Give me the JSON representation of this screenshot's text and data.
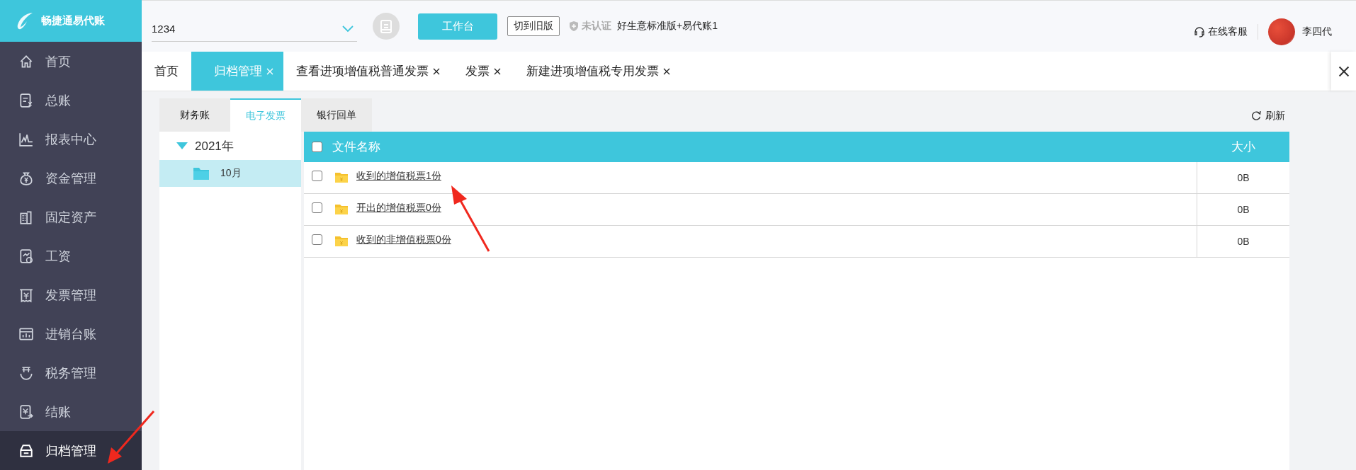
{
  "logo": {
    "text": "畅捷通易代账"
  },
  "topbar": {
    "company_select": {
      "value": "1234"
    },
    "workbench_button": "工作台",
    "old_version_button": "切到旧版",
    "cert_status": "未认证",
    "product": "好生意标准版+易代账1",
    "support": "在线客服",
    "user": "李四代"
  },
  "sidebar": {
    "items": [
      {
        "label": "首页",
        "selected": false
      },
      {
        "label": "总账",
        "selected": false
      },
      {
        "label": "报表中心",
        "selected": false
      },
      {
        "label": "资金管理",
        "selected": false
      },
      {
        "label": "固定资产",
        "selected": false
      },
      {
        "label": "工资",
        "selected": false
      },
      {
        "label": "发票管理",
        "selected": false
      },
      {
        "label": "进销台账",
        "selected": false
      },
      {
        "label": "税务管理",
        "selected": false
      },
      {
        "label": "结账",
        "selected": false
      },
      {
        "label": "归档管理",
        "selected": true
      }
    ]
  },
  "tabs": [
    {
      "label": "首页",
      "closable": false,
      "selected": false
    },
    {
      "label": "归档管理",
      "closable": true,
      "selected": true
    },
    {
      "label": "查看进项增值税普通发票",
      "closable": true,
      "selected": false
    },
    {
      "label": "发票",
      "closable": true,
      "selected": false
    },
    {
      "label": "新建进项增值税专用发票",
      "closable": true,
      "selected": false
    }
  ],
  "subtabs": [
    {
      "label": "财务账",
      "selected": false
    },
    {
      "label": "电子发票",
      "selected": true
    },
    {
      "label": "银行回单",
      "selected": false
    }
  ],
  "refresh": "刷新",
  "tree": [
    {
      "label": "2021年",
      "expanded": true,
      "children": [
        {
          "label": "10月",
          "selected": true
        }
      ]
    }
  ],
  "table": {
    "columns": [
      "文件名称",
      "大小"
    ],
    "header_checked": false,
    "rows": [
      {
        "checked": false,
        "name": "收到的增值税票1份",
        "size": "0B"
      },
      {
        "checked": false,
        "name": "开出的增值税票0份",
        "size": "0B"
      },
      {
        "checked": false,
        "name": "收到的非增值税票0份",
        "size": "0B"
      }
    ]
  }
}
